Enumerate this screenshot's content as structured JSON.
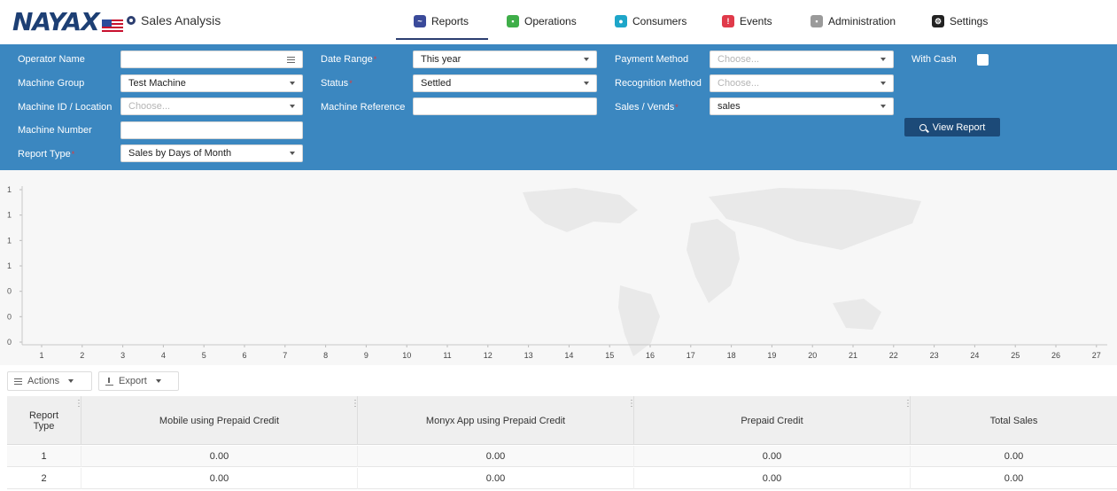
{
  "header": {
    "logo_text": "NAYAX",
    "app_title": "Sales Analysis",
    "nav": [
      {
        "label": "Reports",
        "icon": "chart-icon",
        "color": "#3a4a9a",
        "active": true
      },
      {
        "label": "Operations",
        "icon": "operations-icon",
        "color": "#3fae49"
      },
      {
        "label": "Consumers",
        "icon": "consumers-icon",
        "color": "#1ea6c9"
      },
      {
        "label": "Events",
        "icon": "events-icon",
        "color": "#e03a4a"
      },
      {
        "label": "Administration",
        "icon": "administration-icon",
        "color": "#9a9a9a"
      },
      {
        "label": "Settings",
        "icon": "settings-icon",
        "color": "#222222"
      }
    ]
  },
  "filters": {
    "operator_name": {
      "label": "Operator Name",
      "value": ""
    },
    "machine_group": {
      "label": "Machine Group",
      "value": "Test Machine"
    },
    "machine_id": {
      "label": "Machine ID / Location",
      "placeholder": "Choose..."
    },
    "machine_number": {
      "label": "Machine Number",
      "value": ""
    },
    "report_type": {
      "label": "Report Type",
      "value": "Sales by Days of Month"
    },
    "date_range": {
      "label": "Date Range",
      "value": "This year"
    },
    "status": {
      "label": "Status",
      "value": "Settled"
    },
    "machine_reference": {
      "label": "Machine Reference",
      "value": ""
    },
    "payment_method": {
      "label": "Payment Method",
      "placeholder": "Choose..."
    },
    "recognition_method": {
      "label": "Recognition Method",
      "placeholder": "Choose..."
    },
    "sales_vends": {
      "label": "Sales / Vends",
      "value": "sales"
    },
    "with_cash": {
      "label": "With Cash",
      "checked": false
    },
    "view_report_label": "View Report",
    "required_mark": "*"
  },
  "chart_data": {
    "type": "bar",
    "y_ticks": [
      "1",
      "1",
      "1",
      "1",
      "0",
      "0",
      "0"
    ],
    "categories": [
      "1",
      "2",
      "3",
      "4",
      "5",
      "6",
      "7",
      "8",
      "9",
      "10",
      "11",
      "12",
      "13",
      "14",
      "15",
      "16",
      "17",
      "18",
      "19",
      "20",
      "21",
      "22",
      "23",
      "24",
      "25",
      "26",
      "27"
    ],
    "values": [
      0,
      0,
      0,
      0,
      0,
      0,
      0,
      0,
      0,
      0,
      0,
      0,
      0,
      0,
      0,
      0,
      0,
      0,
      0,
      0,
      0,
      0,
      0,
      0,
      0,
      0,
      0
    ],
    "grid": false,
    "background": "world-map-watermark"
  },
  "toolbar": {
    "actions_label": "Actions",
    "export_label": "Export"
  },
  "table": {
    "columns": [
      "Report Type",
      "Mobile using Prepaid Credit",
      "Monyx App using Prepaid Credit",
      "Prepaid Credit",
      "Total Sales"
    ],
    "rows": [
      [
        "1",
        "0.00",
        "0.00",
        "0.00",
        "0.00"
      ],
      [
        "2",
        "0.00",
        "0.00",
        "0.00",
        "0.00"
      ]
    ]
  }
}
